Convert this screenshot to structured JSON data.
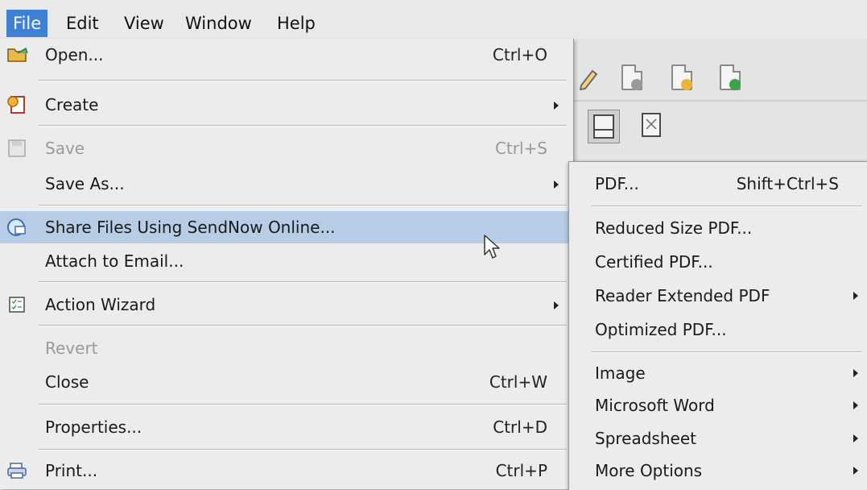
{
  "menubar": {
    "items": [
      {
        "label": "File",
        "active": true
      },
      {
        "label": "Edit"
      },
      {
        "label": "View"
      },
      {
        "label": "Window"
      },
      {
        "label": "Help"
      }
    ]
  },
  "toolbar": {
    "icons": [
      "edit-icon",
      "document-delete-icon",
      "document-export-icon",
      "document-download-icon",
      "save-page-icon",
      "page-fit-icon"
    ]
  },
  "file_menu": {
    "items": [
      {
        "label": "Open...",
        "shortcut": "Ctrl+O",
        "icon": "open-folder-icon"
      },
      {
        "label": "Create",
        "submenu": true,
        "icon": "create-pdf-icon"
      },
      {
        "label": "Save",
        "shortcut": "Ctrl+S",
        "disabled": true,
        "icon": "save-icon"
      },
      {
        "label": "Save As...",
        "submenu": true
      },
      {
        "label": "Share Files Using SendNow Online...",
        "highlighted": true,
        "icon": "share-icon"
      },
      {
        "label": "Attach to Email..."
      },
      {
        "label": "Action Wizard",
        "submenu": true,
        "icon": "action-wizard-icon"
      },
      {
        "label": "Revert",
        "disabled": true
      },
      {
        "label": "Close",
        "shortcut": "Ctrl+W"
      },
      {
        "label": "Properties...",
        "shortcut": "Ctrl+D"
      },
      {
        "label": "Print...",
        "shortcut": "Ctrl+P",
        "icon": "printer-icon"
      }
    ]
  },
  "save_as_submenu": {
    "items": [
      {
        "label": "PDF...",
        "shortcut": "Shift+Ctrl+S"
      },
      {
        "label": "Reduced Size PDF..."
      },
      {
        "label": "Certified PDF..."
      },
      {
        "label": "Reader Extended PDF",
        "submenu": true
      },
      {
        "label": "Optimized PDF..."
      },
      {
        "label": "Image",
        "submenu": true
      },
      {
        "label": "Microsoft Word",
        "submenu": true
      },
      {
        "label": "Spreadsheet",
        "submenu": true
      },
      {
        "label": "More Options",
        "submenu": true
      }
    ]
  },
  "colors": {
    "active_menu": "#3f7fd4",
    "highlight": "#b7cde6",
    "menu_bg": "#ececec"
  }
}
